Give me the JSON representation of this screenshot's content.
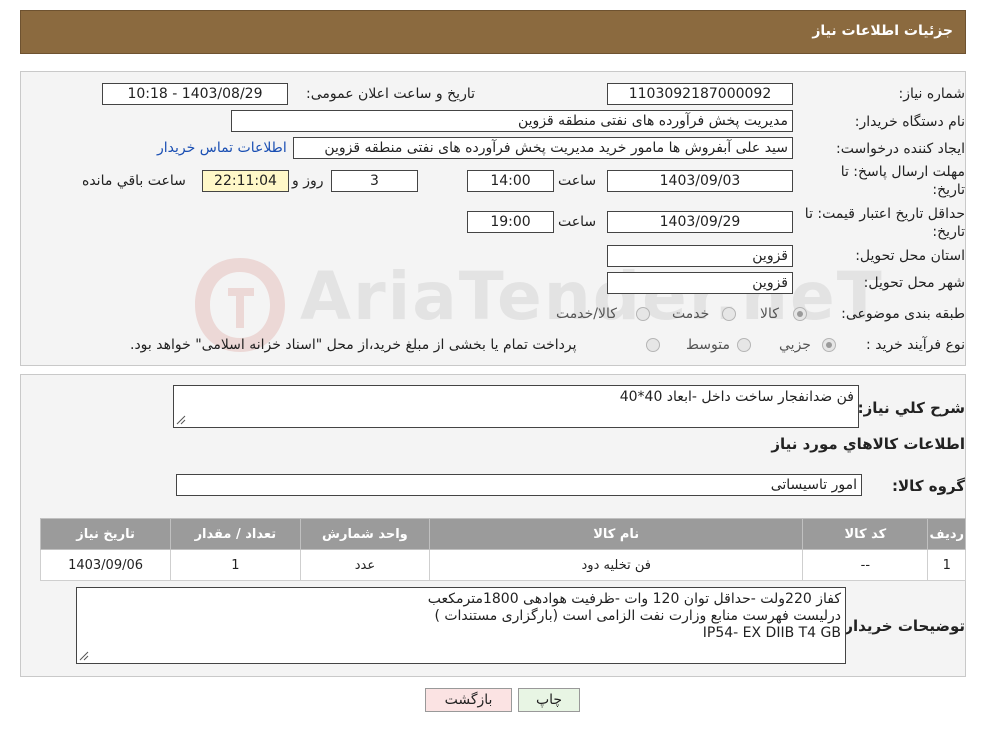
{
  "header": {
    "title": "جزئیات اطلاعات نیاز"
  },
  "form": {
    "need_number_label": "شماره نیاز:",
    "need_number": "1103092187000092",
    "announce_label": "تاریخ و ساعت اعلان عمومی:",
    "announce_value": "1403/08/29 - 10:18",
    "buyer_org_label": "نام دستگاه خریدار:",
    "buyer_org": "مدیریت پخش فرآورده های نفتی منطقه قزوین",
    "creator_label": "ایجاد کننده درخواست:",
    "creator": "سید علی  آبفروش ها مامور خرید مدیریت پخش فرآورده های نفتی منطقه قزوین",
    "contact_link": "اطلاعات تماس خریدار",
    "deadline_label_1": "مهلت ارسال پاسخ: تا",
    "deadline_label_2": "تاریخ:",
    "deadline_date": "1403/09/03",
    "time_label": "ساعت",
    "deadline_time": "14:00",
    "days_count": "3",
    "days_label": "روز و",
    "remaining_time": "22:11:04",
    "remaining_label": "ساعت باقي مانده",
    "validity_label_1": "حداقل تاریخ اعتبار قیمت: تا",
    "validity_label_2": "تاریخ:",
    "validity_date": "1403/09/29",
    "validity_time": "19:00",
    "province_label": "استان محل تحویل:",
    "province": "قزوین",
    "city_label": "شهر محل تحویل:",
    "city": "قزوین",
    "category_label": "طبقه بندی موضوعی:",
    "category_options": [
      "کالا",
      "خدمت",
      "کالا/خدمت"
    ],
    "process_label": "نوع فرآیند خرید :",
    "process_options": [
      "جزیي",
      "متوسط"
    ],
    "process_note": "پرداخت تمام یا بخشی از مبلغ خرید،از محل \"اسناد خزانه اسلامی\" خواهد بود."
  },
  "details": {
    "summary_label": "شرح کلي نياز:",
    "summary": "فن ضدانفجار ساخت داخل -ابعاد 40*40",
    "goods_title": "اطلاعات کالاهاي مورد نياز",
    "group_label": "گروه کالا:",
    "group_value": "امور تاسیساتی",
    "table_headers": [
      "ردیف",
      "کد کالا",
      "نام کالا",
      "واحد شمارش",
      "تعداد / مقدار",
      "تاریخ نیاز"
    ],
    "table_rows": [
      [
        "1",
        "--",
        "فن تخلیه دود",
        "عدد",
        "1",
        "1403/09/06"
      ]
    ],
    "buyer_notes_label": "توضیحات خریدار:",
    "buyer_notes": [
      "کفاز 220ولت -حداقل توان 120 وات -ظرفیت هوادهی 1800مترمکعب",
      "درلیست فهرست منابع وزارت نفت الزامی است (بارگزاری مستندات )",
      "IP54- EX DIIB T4 GB"
    ]
  },
  "buttons": {
    "print": "چاپ",
    "back": "بازگشت"
  },
  "colors": {
    "header": "#8b6a3f",
    "table_header": "#9b9b9b",
    "link": "#1a4fb3",
    "back_button": "#fbe3e3",
    "print_button": "#e8f5e4"
  }
}
